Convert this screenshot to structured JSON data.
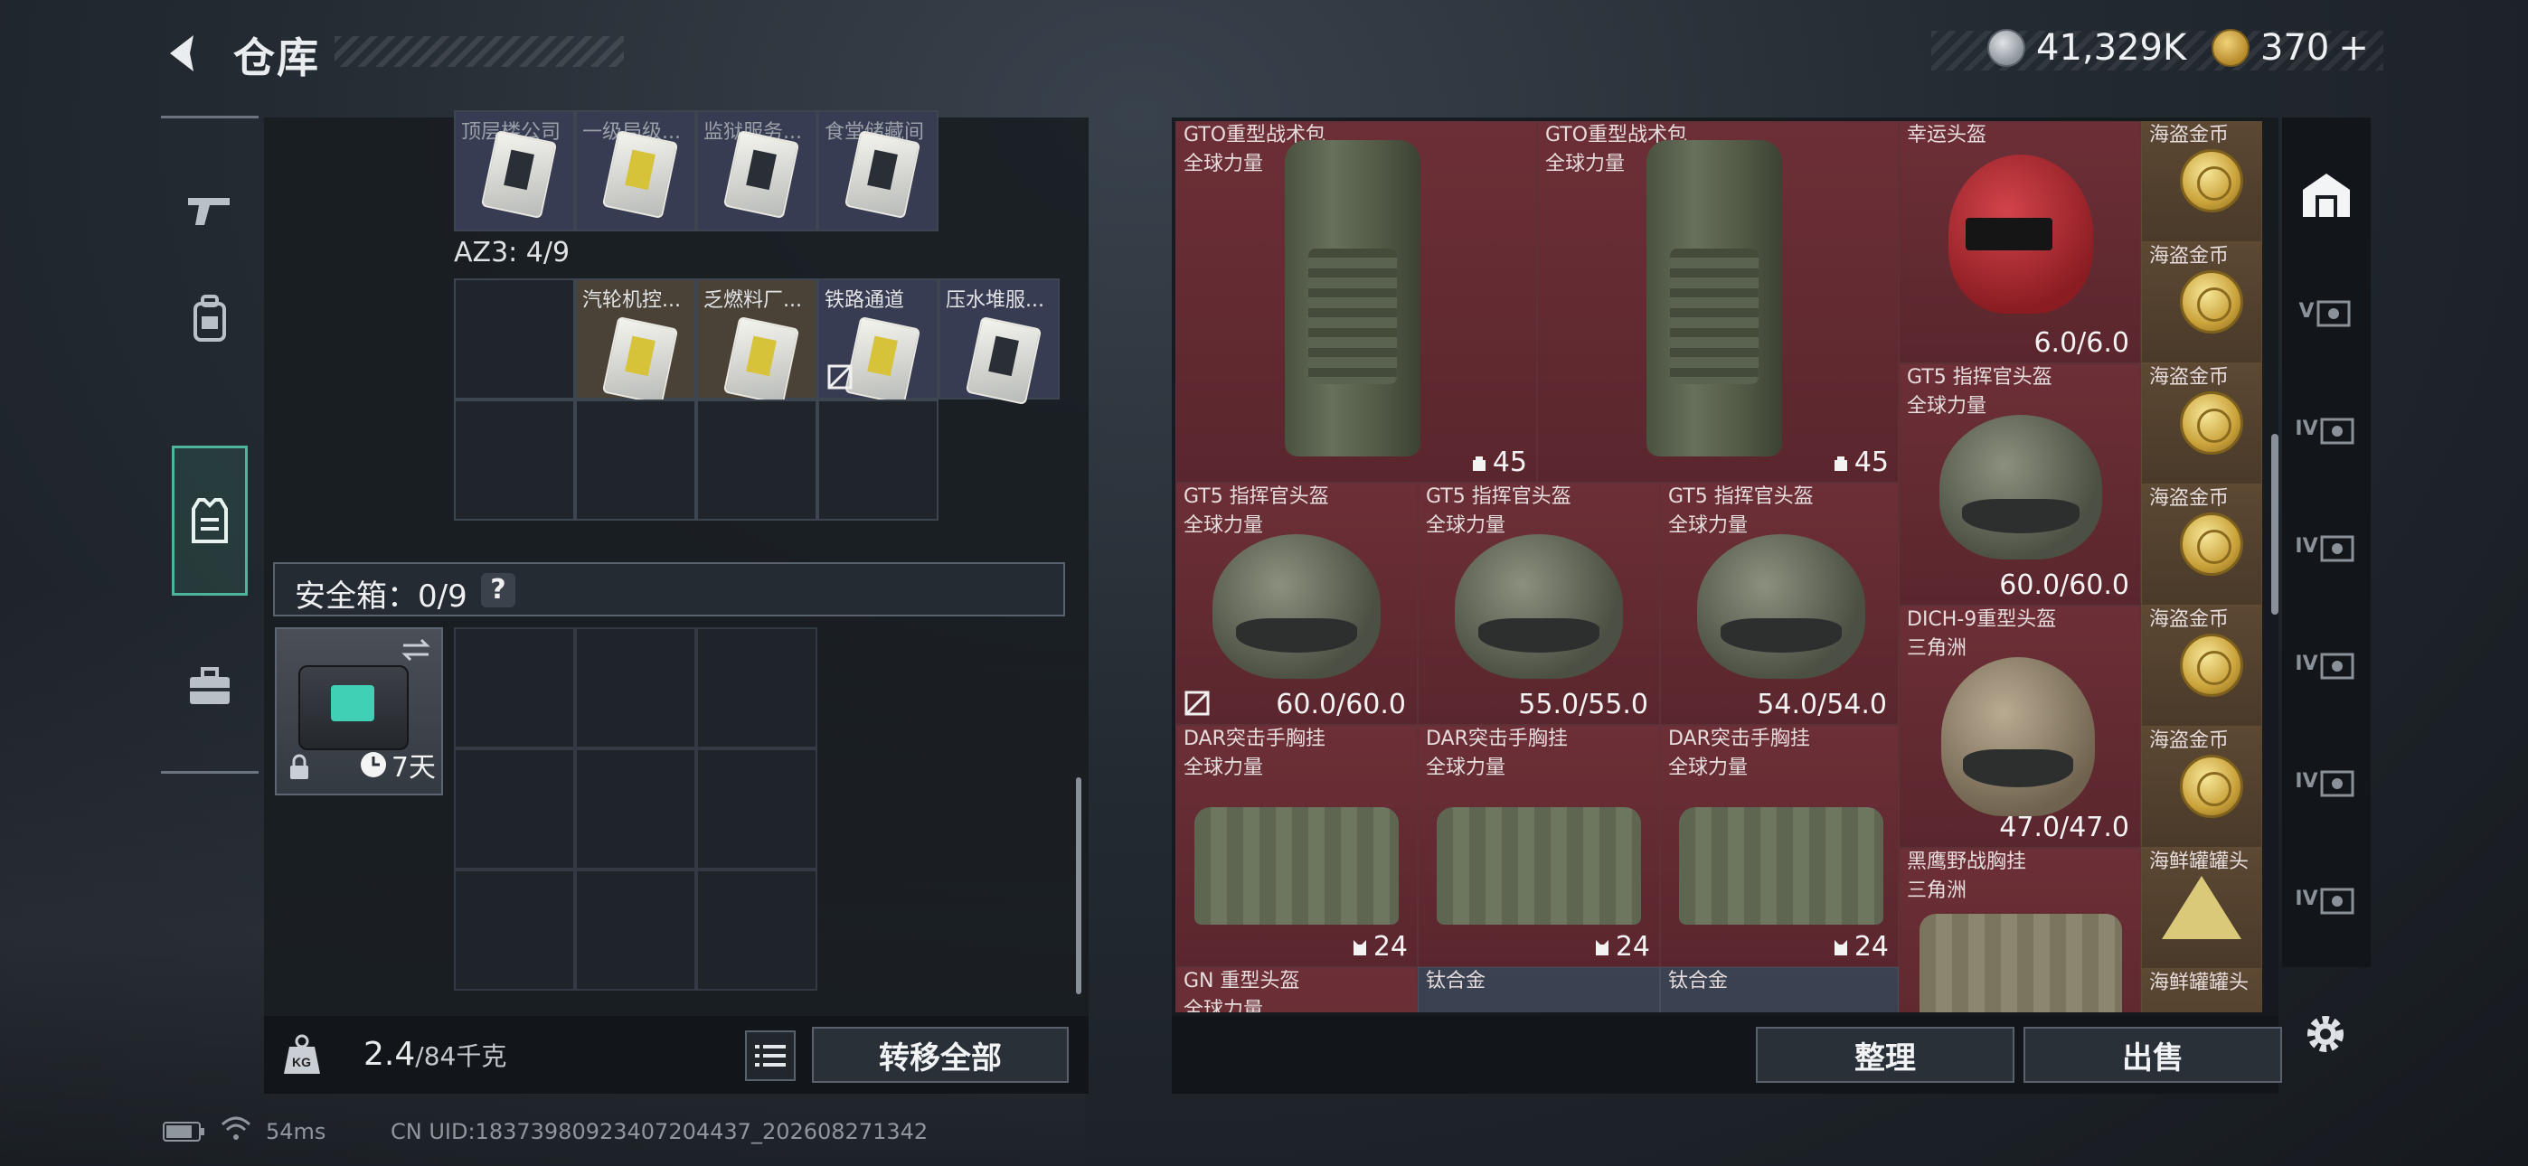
{
  "header": {
    "title": "仓库"
  },
  "currency": [
    {
      "icon": "silver-coin-icon",
      "value": "41,329K"
    },
    {
      "icon": "gold-coin-icon",
      "value": "370"
    }
  ],
  "currency_add": "+",
  "side_nav": [
    {
      "icon": "pistol-icon",
      "active": false
    },
    {
      "icon": "backpack-icon",
      "active": false
    },
    {
      "icon": "vest-icon",
      "active": true
    },
    {
      "icon": "toolbox-icon",
      "active": false
    }
  ],
  "left": {
    "top_row_labels": [
      "顶层楼公司",
      "一级局级...",
      "监狱服务...",
      "食堂储藏间"
    ],
    "az3_label": "AZ3: 4/9",
    "az3_items": [
      "汽轮机控...",
      "乏燃料厂...",
      "铁路通道",
      "压水堆服..."
    ],
    "safebox_label": "安全箱：0/9",
    "safebox_help": "?",
    "safebox_item_time": "7天",
    "weight_value": "2.4",
    "weight_unit": "/84千克",
    "transfer_all": "转移全部"
  },
  "status": {
    "ping": "54ms",
    "uid": "CN UID:18373980923407204437_202608271342"
  },
  "right": {
    "items": {
      "bag1": {
        "name": "GTO重型战术包",
        "sub": "全球力量",
        "qty": "45"
      },
      "bag2": {
        "name": "GTO重型战术包",
        "sub": "全球力量",
        "qty": "45"
      },
      "lucky_helmet": {
        "name": "幸运头盔",
        "val": "6.0/6.0"
      },
      "gt5_a": {
        "name": "GT5 指挥官头盔",
        "sub": "全球力量",
        "val": "60.0/60.0"
      },
      "gt5_b": {
        "name": "GT5 指挥官头盔",
        "sub": "全球力量",
        "val": "60.0/60.0"
      },
      "gt5_c": {
        "name": "GT5 指挥官头盔",
        "sub": "全球力量",
        "val": "55.0/55.0"
      },
      "gt5_d": {
        "name": "GT5 指挥官头盔",
        "sub": "全球力量",
        "val": "54.0/54.0"
      },
      "dich": {
        "name": "DICH-9重型头盔",
        "sub": "三角洲",
        "val": "47.0/47.0"
      },
      "dar_a": {
        "name": "DAR突击手胸挂",
        "sub": "全球力量",
        "qty": "24"
      },
      "dar_b": {
        "name": "DAR突击手胸挂",
        "sub": "全球力量",
        "qty": "24"
      },
      "dar_c": {
        "name": "DAR突击手胸挂",
        "sub": "全球力量",
        "qty": "24"
      },
      "blackhawk": {
        "name": "黑鹰野战胸挂",
        "sub": "三角洲"
      },
      "gn": {
        "name": "GN 重型头盔",
        "sub": "全球力量"
      },
      "ti_a": {
        "name": "钛合金"
      },
      "ti_b": {
        "name": "钛合金"
      },
      "coin_label": "海盗金币",
      "seafood_label": "海鲜罐罐头"
    },
    "filters": [
      "V",
      "IV",
      "IV",
      "IV",
      "IV",
      "IV"
    ],
    "sort": "整理",
    "sell": "出售"
  }
}
